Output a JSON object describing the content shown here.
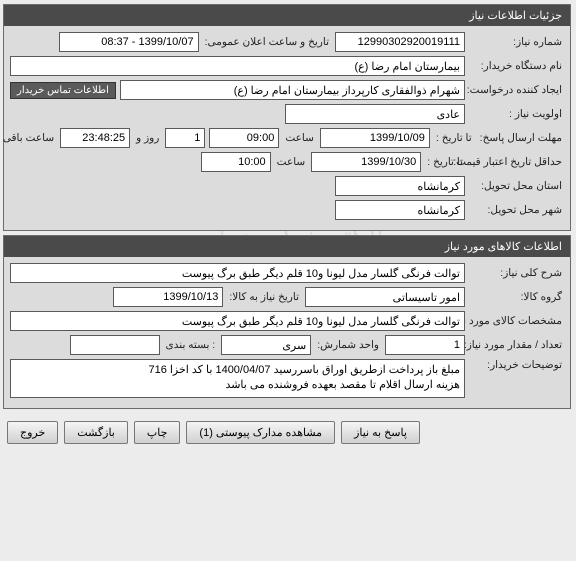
{
  "watermark": {
    "line1": "سامانه تدارکات الکترونیکی دولت",
    "line2": "مرکز توسعه تجارت الکترونیکی",
    "line3": "۰۲۱-۴۱۹۳۴"
  },
  "needInfo": {
    "header": "جزئیات اطلاعات نیاز",
    "needNumberLabel": "شماره نیاز:",
    "needNumber": "12990302920019111",
    "announceLabel": "تاریخ و ساعت اعلان عمومی:",
    "announceValue": "1399/10/07 - 08:37",
    "orgLabel": "نام دستگاه خریدار:",
    "orgValue": "بیمارستان امام رضا (ع)",
    "creatorLabel": "ایجاد کننده درخواست:",
    "creatorValue": "شهرام ذوالفقاری کارپرداز بیمارستان امام رضا (ع)",
    "contactButton": "اطلاعات تماس خریدار",
    "priorityLabel": "اولویت نیاز :",
    "priorityValue": "عادی",
    "deadlineLabel": "مهلت ارسال پاسخ:",
    "toDateLabel": "تا تاریخ :",
    "deadlineDate": "1399/10/09",
    "timeLabel": "ساعت",
    "deadlineTime": "09:00",
    "dayLabel": "روز و",
    "daysLeft": "1",
    "hoursLeft": "23:48:25",
    "remainingLabel": "ساعت باقی مانده",
    "minValidityLabel": "حداقل تاریخ اعتبار قیمت:",
    "validityDate": "1399/10/30",
    "validityTime": "10:00",
    "deliveryProvinceLabel": "استان محل تحویل:",
    "deliveryProvince": "کرمانشاه",
    "deliveryCityLabel": "شهر محل تحویل:",
    "deliveryCity": "کرمانشاه"
  },
  "goodsInfo": {
    "header": "اطلاعات کالاهای مورد نیاز",
    "descLabel": "شرح کلی نیاز:",
    "descValue": "توالت فرنگی گلسار مدل لیونا و10 قلم دیگر طبق برگ پیوست",
    "groupLabel": "گروه کالا:",
    "groupValue": "امور تاسیساتی",
    "needByLabel": "تاریخ نیاز به کالا:",
    "needByDate": "1399/10/13",
    "specLabel": "مشخصات کالای مورد نیاز:",
    "specValue": "توالت فرنگی گلسار مدل لیونا و10 قلم دیگر طبق برگ پیوست",
    "qtyLabel": "تعداد / مقدار مورد نیاز:",
    "qtyValue": "1",
    "unitLabel": "واحد شمارش:",
    "unitValue": "سری",
    "packLabel": ": بسته بندی",
    "packValue": "",
    "buyerNotesLabel": "توضیحات خریدار:",
    "buyerNotesValue": "مبلغ باز پرداخت ازطریق اوراق باسررسید 1400/04/07 با کد اخزا 716\nهزینه ارسال اقلام تا مقصد بعهده فروشنده می باشد"
  },
  "buttons": {
    "respond": "پاسخ به نیاز",
    "attachments": "مشاهده مدارک پیوستی (1)",
    "print": "چاپ",
    "back": "بازگشت",
    "exit": "خروج"
  }
}
